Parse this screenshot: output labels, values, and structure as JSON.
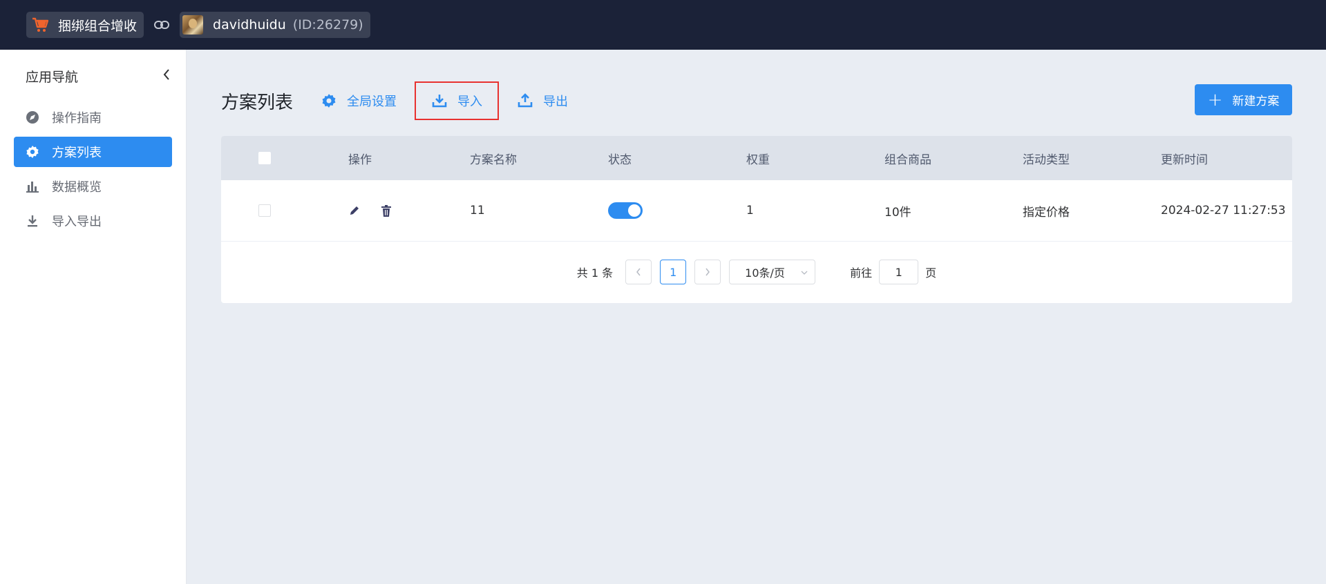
{
  "topbar": {
    "app_name": "捆绑组合增收",
    "username": "davidhuidu",
    "user_id": "(ID:26279)"
  },
  "sidebar": {
    "title": "应用导航",
    "items": [
      {
        "label": "操作指南",
        "icon": "compass-icon",
        "active": false
      },
      {
        "label": "方案列表",
        "icon": "gear-icon",
        "active": true
      },
      {
        "label": "数据概览",
        "icon": "bar-chart-icon",
        "active": false
      },
      {
        "label": "导入导出",
        "icon": "download-icon",
        "active": false
      }
    ]
  },
  "main": {
    "title": "方案列表",
    "toolbar": {
      "settings_label": "全局设置",
      "import_label": "导入",
      "export_label": "导出",
      "new_label": "新建方案"
    },
    "table": {
      "headers": [
        "操作",
        "方案名称",
        "状态",
        "权重",
        "组合商品",
        "活动类型",
        "更新时间"
      ],
      "rows": [
        {
          "name": "11",
          "status_on": true,
          "weight": "1",
          "products": "10件",
          "activity_type": "指定价格",
          "updated": "2024-02-27 11:27:53"
        }
      ]
    },
    "pagination": {
      "total": "共 1 条",
      "current_page": "1",
      "page_size": "10条/页",
      "goto_prefix": "前往",
      "goto_value": "1",
      "goto_suffix": "页"
    }
  },
  "colors": {
    "topbar": "#1b2238",
    "accent": "#2d8cf0",
    "highlight_border": "#e8312f",
    "cart_icon": "#f0642d"
  }
}
